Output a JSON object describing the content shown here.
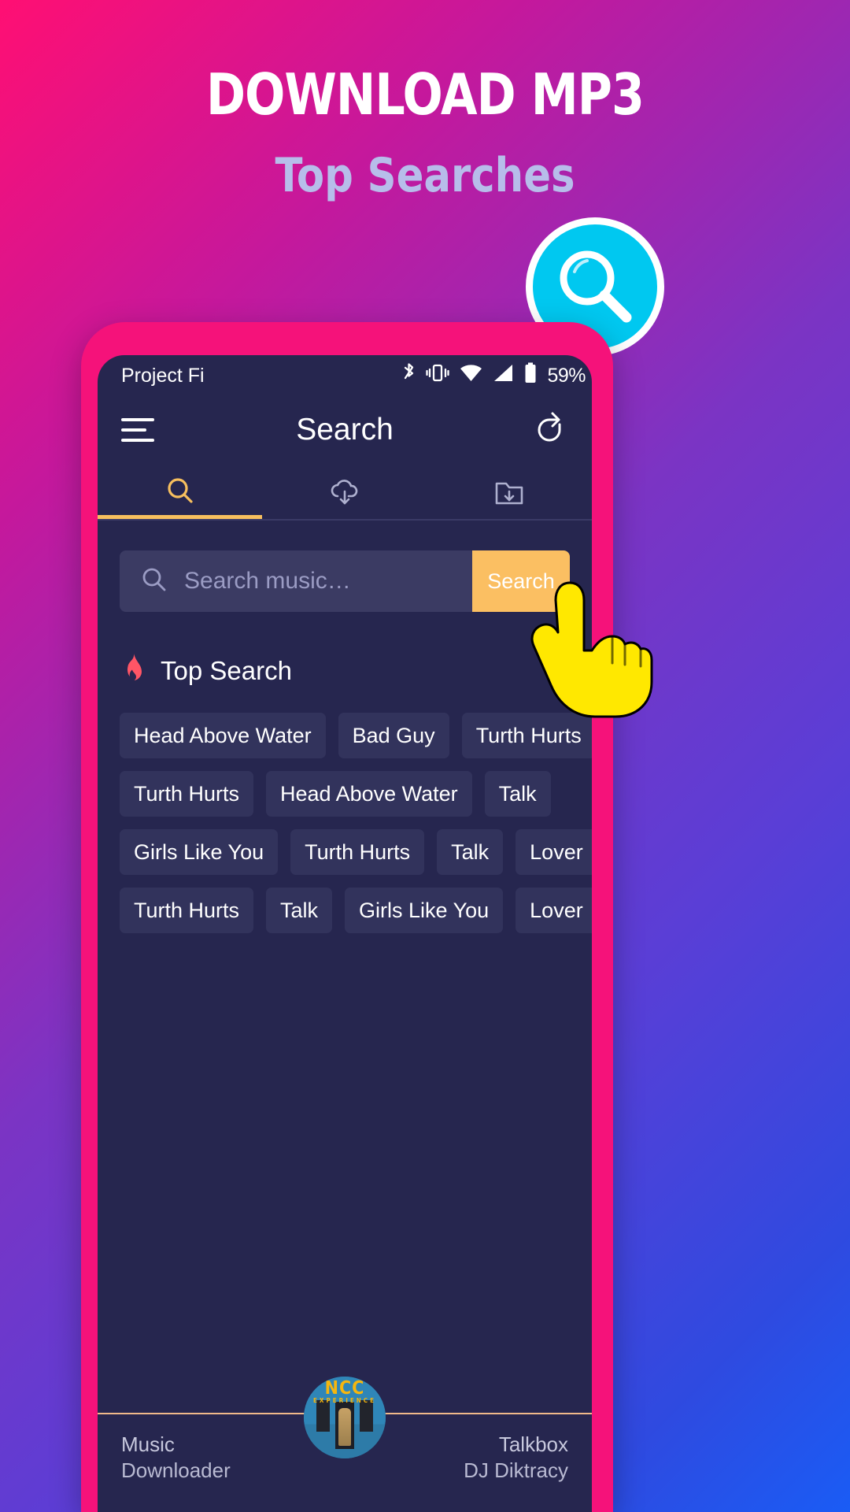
{
  "promo": {
    "title": "DOWNLOAD MP3",
    "subtitle": "Top Searches",
    "badge_icon": "search-icon",
    "title_color": "#ffffff",
    "subtitle_color": "#b7bdea",
    "badge_color": "#00c8f0"
  },
  "phone": {
    "frame_color": "#f5127a",
    "screen_bg": "#26264f"
  },
  "status_bar": {
    "carrier": "Project Fi",
    "battery_percent": "59%",
    "icons": [
      "bluetooth-icon",
      "vibrate-icon",
      "wifi-icon",
      "signal-icon",
      "battery-icon"
    ]
  },
  "app_bar": {
    "menu_icon": "hamburger-menu-icon",
    "title": "Search",
    "share_icon": "share-icon"
  },
  "tabs": [
    {
      "id": "search",
      "icon": "search-icon",
      "active": true
    },
    {
      "id": "downloading",
      "icon": "cloud-download-icon",
      "active": false
    },
    {
      "id": "downloaded",
      "icon": "folder-download-icon",
      "active": false
    }
  ],
  "tab_accent_color": "#f7bf5e",
  "search": {
    "placeholder": "Search music…",
    "value": "",
    "icon": "search-icon",
    "button_label": "Search",
    "button_color": "#fbbf62"
  },
  "top_search": {
    "icon": "flame-icon",
    "icon_color": "#ff5566",
    "heading": "Top Search",
    "rows": [
      [
        "Head Above Water",
        "Bad Guy",
        "Turth Hurts"
      ],
      [
        "Turth Hurts",
        "Head Above Water",
        "Talk"
      ],
      [
        "Girls Like You",
        "Turth Hurts",
        "Talk",
        "Lover"
      ],
      [
        "Turth Hurts",
        "Talk",
        "Girls Like You",
        "Lover"
      ]
    ]
  },
  "player": {
    "left_line1": "Music",
    "left_line2": "Downloader",
    "right_line1": "Talkbox",
    "right_line2": "DJ Diktracy",
    "album_art_text": "NCC",
    "album_art_subtext": "EXPERIENCE",
    "divider_color": "#f0b98a"
  },
  "cursor": {
    "icon": "hand-pointer-icon",
    "color": "#ffe800"
  }
}
